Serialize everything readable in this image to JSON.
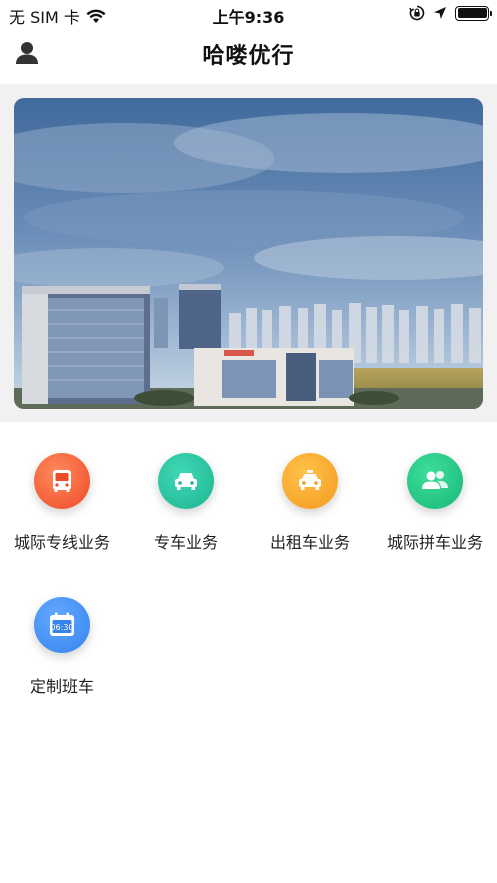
{
  "status_bar": {
    "carrier": "无 SIM 卡",
    "time": "上午9:36"
  },
  "nav": {
    "title": "哈喽优行"
  },
  "services": [
    {
      "label": "城际专线业务",
      "icon": "bus-icon",
      "color": "#ee4a28"
    },
    {
      "label": "专车业务",
      "icon": "car-icon",
      "color": "#1fb592"
    },
    {
      "label": "出租车业务",
      "icon": "taxi-icon",
      "color": "#f5991f"
    },
    {
      "label": "城际拼车业务",
      "icon": "carpool-icon",
      "color": "#18b777"
    },
    {
      "label": "定制班车",
      "icon": "schedule-icon",
      "color": "#3683ee",
      "icon_text": "06:30"
    }
  ]
}
